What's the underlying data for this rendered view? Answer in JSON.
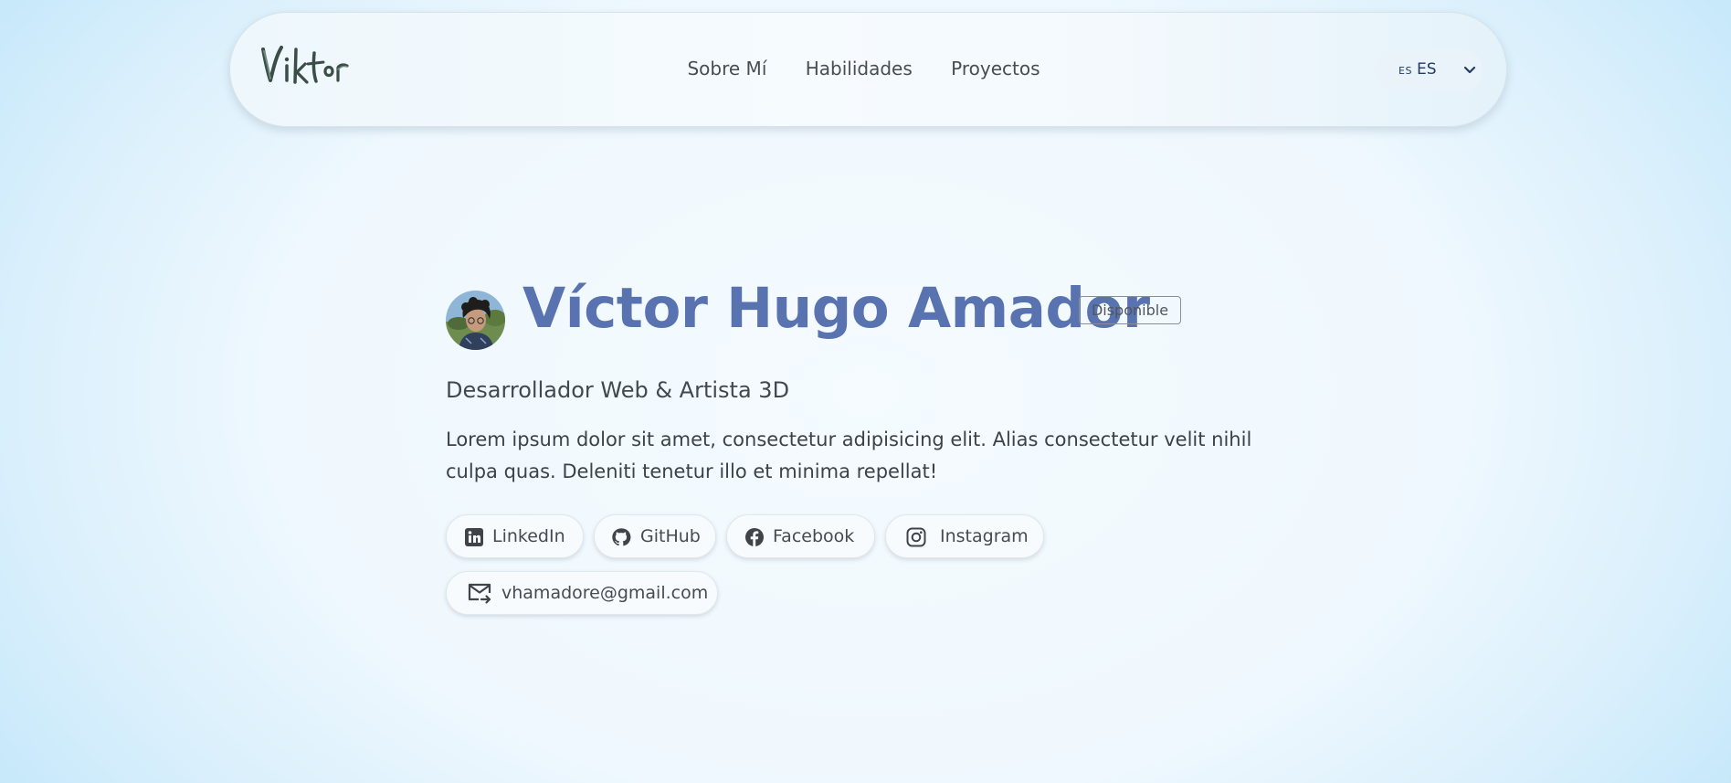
{
  "header": {
    "logo_text": "Viktor",
    "nav": [
      {
        "label": "Sobre Mí"
      },
      {
        "label": "Habilidades"
      },
      {
        "label": "Proyectos"
      }
    ],
    "language": {
      "flag": "ES",
      "code": "ES"
    }
  },
  "hero": {
    "name": "Víctor Hugo Amador",
    "badge": "Disponible",
    "role": "Desarrollador Web & Artista 3D",
    "description": "Lorem ipsum dolor sit amet, consectetur adipisicing elit. Alias consectetur velit nihil culpa quas. Deleniti tenetur illo et minima repellat!"
  },
  "contact": {
    "linkedin": "LinkedIn",
    "github": "GitHub",
    "facebook": "Facebook",
    "instagram": "Instagram",
    "email": "vhamadore@gmail.com"
  },
  "colors": {
    "name": "#5873b0",
    "text": "#3f4448",
    "background": "#eff8fe",
    "edge": "#c2e7fa"
  }
}
